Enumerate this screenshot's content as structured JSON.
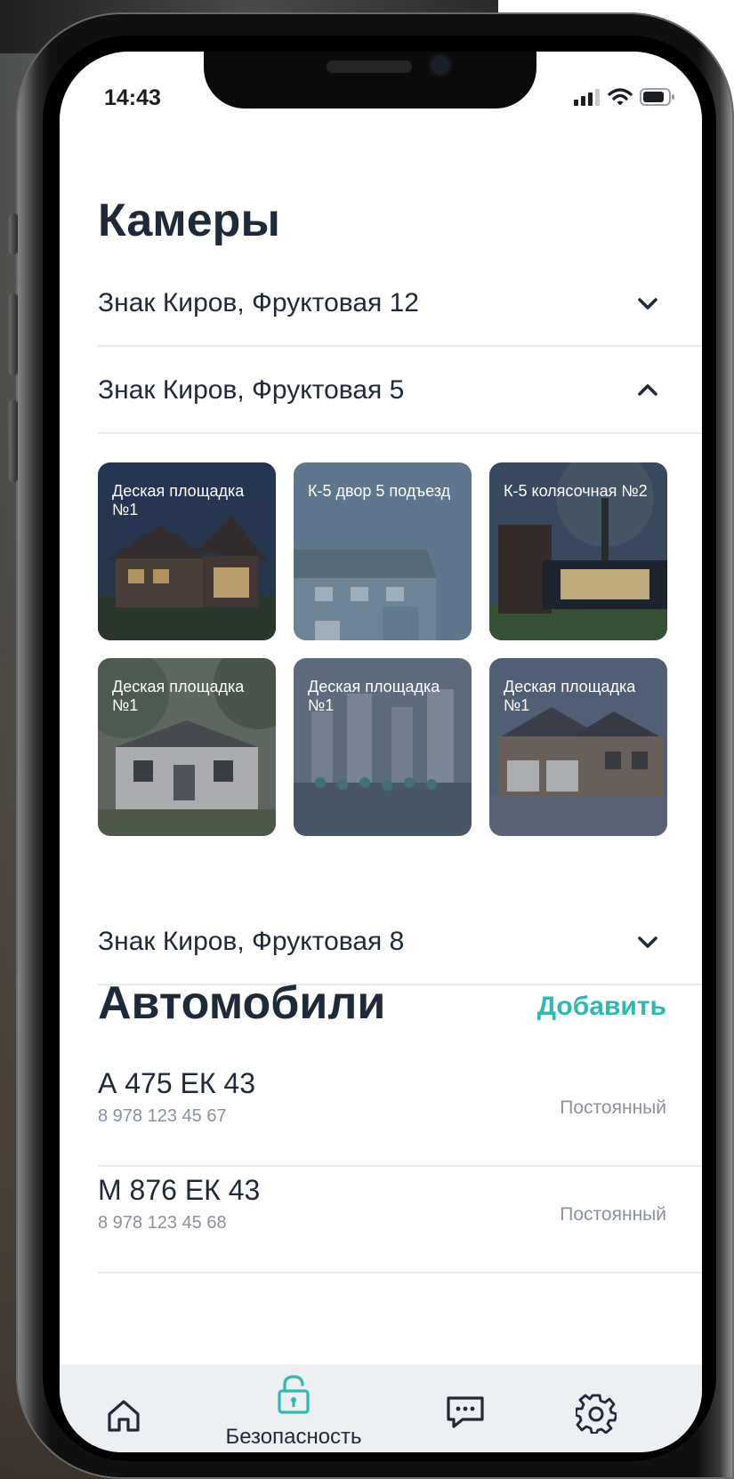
{
  "status_bar": {
    "time": "14:43"
  },
  "cameras": {
    "title": "Камеры",
    "groups": [
      {
        "label": "Знак Киров, Фруктовая 12",
        "expanded": false
      },
      {
        "label": "Знак Киров, Фруктовая 5",
        "expanded": true
      },
      {
        "label": "Знак Киров, Фруктовая 8",
        "expanded": false
      }
    ],
    "tiles": [
      {
        "label": "Деская площадка №1",
        "theme": "house-dusk"
      },
      {
        "label": "К-5 двор 5 подъезд",
        "theme": "blue-house"
      },
      {
        "label": "К-5 колясочная №2",
        "theme": "modern-house"
      },
      {
        "label": "Деская площадка №1",
        "theme": "white-house"
      },
      {
        "label": "Деская площадка №1",
        "theme": "city-kids"
      },
      {
        "label": "Деская площадка №1",
        "theme": "brick-house"
      }
    ]
  },
  "cars": {
    "title": "Автомобили",
    "add_label": "Добавить",
    "items": [
      {
        "plate": "А 475 ЕК 43",
        "phone": "8 978 123 45 67",
        "type": "Постоянный"
      },
      {
        "plate": "М 876 ЕК 43",
        "phone": "8 978 123 45 68",
        "type": "Постоянный"
      }
    ]
  },
  "tabbar": {
    "active": "security",
    "items": [
      {
        "icon": "home-icon",
        "label": ""
      },
      {
        "icon": "lock-icon",
        "label": "Безопасность"
      },
      {
        "icon": "chat-icon",
        "label": ""
      },
      {
        "icon": "gear-icon",
        "label": ""
      }
    ]
  },
  "colors": {
    "accent": "#2fb8b0",
    "heading": "#1e2a3a",
    "muted": "#8a929b",
    "tabbar_bg": "#edf0f3"
  }
}
